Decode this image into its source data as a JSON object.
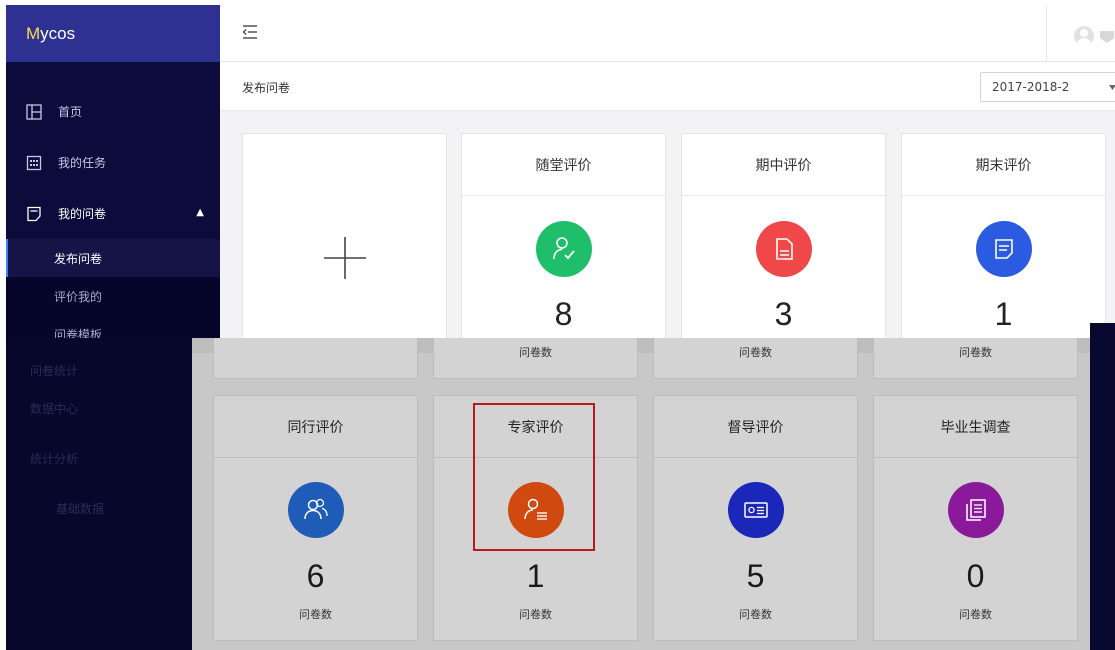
{
  "brand": {
    "logo_prefix": "M",
    "logo_rest": "ycos",
    "accent": "#2e3192",
    "sidebar_bg": "#0b0b3c"
  },
  "sidebar": {
    "items": [
      {
        "label": "首页",
        "icon": "layout-icon"
      },
      {
        "label": "我的任务",
        "icon": "calendar-icon"
      },
      {
        "label": "我的问卷",
        "icon": "document-icon",
        "expanded": true
      }
    ],
    "sub_items": [
      {
        "label": "发布问卷",
        "active": true
      },
      {
        "label": "评价我的",
        "active": false
      },
      {
        "label": "问卷模板",
        "active": false
      }
    ],
    "faded_items": [
      "问卷统计",
      "数据中心",
      "统计分析",
      "基础数据"
    ]
  },
  "topbar": {
    "menu_icon": "menu-collapse-icon",
    "avatar_icon": "user-avatar-icon"
  },
  "breadcrumb": {
    "current": "发布问卷"
  },
  "term_select": {
    "value": "2017-2018-2"
  },
  "count_label": "问卷数",
  "top_cards": [
    {
      "title": "随堂评价",
      "count": "8",
      "color": "#1fbe6a",
      "icon": "person-check-icon"
    },
    {
      "title": "期中评价",
      "count": "3",
      "color": "#f04848",
      "icon": "file-icon"
    },
    {
      "title": "期末评价",
      "count": "1",
      "color": "#2b5be0",
      "icon": "notepad-icon"
    }
  ],
  "bottom_cards": [
    {
      "title": "同行评价",
      "count": "6",
      "color": "#1f5cb8",
      "icon": "people-icon"
    },
    {
      "title": "专家评价",
      "count": "1",
      "color": "#d04a10",
      "icon": "expert-icon",
      "highlighted": true
    },
    {
      "title": "督导评价",
      "count": "5",
      "color": "#1a27b8",
      "icon": "id-card-icon"
    },
    {
      "title": "毕业生调查",
      "count": "0",
      "color": "#8a1a9a",
      "icon": "stacked-docs-icon"
    }
  ]
}
